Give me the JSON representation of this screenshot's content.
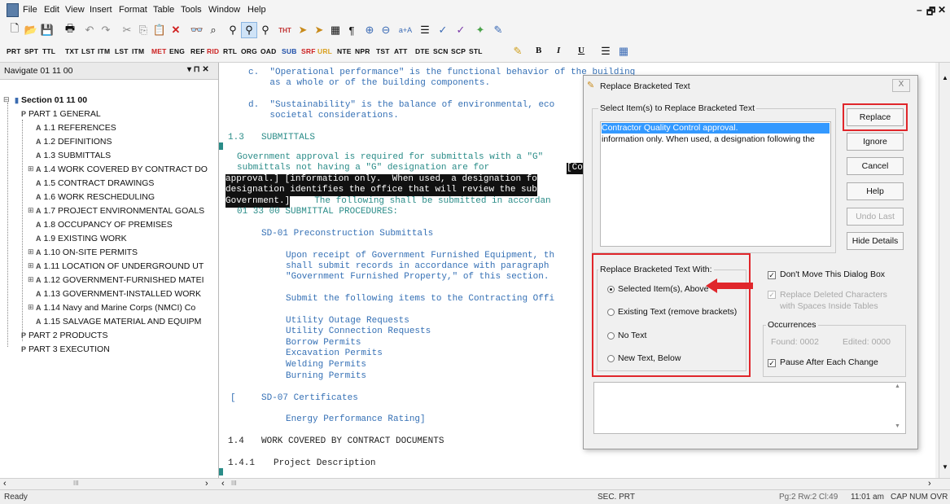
{
  "menu": [
    "File",
    "Edit",
    "View",
    "Insert",
    "Format",
    "Table",
    "Tools",
    "Window",
    "Help"
  ],
  "window_controls": {
    "minimize": "–",
    "restore": "🗗",
    "close": "✕"
  },
  "toolbar2": [
    "PRT",
    "SPT",
    "TTL",
    "TXT",
    "LST",
    "ITM",
    "LST",
    "ITM",
    "MET",
    "ENG",
    "REF",
    "RID",
    "RTL",
    "ORG",
    "OAD",
    "SUB",
    "SRF",
    "URL",
    "NTE",
    "NPR",
    "TST",
    "ATT",
    "DTE",
    "SCN",
    "SCP",
    "STL",
    "B",
    "I",
    "U"
  ],
  "navigator": {
    "title": "Navigate 01 11 00",
    "pin": "▾ ⊓ ✕",
    "items": [
      {
        "label": "Section 01 11 00"
      },
      {
        "label": "PART 1  GENERAL"
      },
      {
        "label": "1.1  REFERENCES"
      },
      {
        "label": "1.2  DEFINITIONS"
      },
      {
        "label": "1.3  SUBMITTALS"
      },
      {
        "label": "1.4  WORK COVERED BY CONTRACT DO"
      },
      {
        "label": "1.5  CONTRACT DRAWINGS"
      },
      {
        "label": "1.6  WORK RESCHEDULING"
      },
      {
        "label": "1.7  PROJECT ENVIRONMENTAL GOALS"
      },
      {
        "label": "1.8  OCCUPANCY OF PREMISES"
      },
      {
        "label": "1.9  EXISTING WORK"
      },
      {
        "label": "1.10  ON-SITE PERMITS"
      },
      {
        "label": "1.11  LOCATION OF UNDERGROUND UT"
      },
      {
        "label": "1.12  GOVERNMENT-FURNISHED MATEI"
      },
      {
        "label": "1.13  GOVERNMENT-INSTALLED WORK"
      },
      {
        "label": "1.14  Navy and Marine Corps (NMCI) Co"
      },
      {
        "label": "1.15  SALVAGE MATERIAL AND EQUIPM"
      },
      {
        "label": "PART 2  PRODUCTS"
      },
      {
        "label": "PART 3  EXECUTION"
      }
    ]
  },
  "document": {
    "lines": [
      "c.  \"Operational performance\" is the functional behavior of the building",
      "    as a whole or of the building components.",
      "d.  \"Sustainability\" is the balance of environmental, eco",
      "    societal considerations.",
      "1.3",
      "SUBMITTALS",
      "Government approval is required for submittals with a \"G\"",
      "submittals not having a \"G\" designation are for ",
      "[Contracto",
      "approval.] [information only.  When used, a designation fo",
      "designation identifies the office that will review the sub",
      "Government.]",
      "  The following shall be submitted in accordan",
      "01 33 00 SUBMITTAL PROCEDURES:",
      "SD-01 Preconstruction Submittals",
      "Upon receipt of Government Furnished Equipment, th",
      "shall submit records in accordance with paragraph",
      "\"Government Furnished Property,\" of this section.",
      "Submit the following items to the Contracting Offi",
      "Utility Outage Requests",
      "Utility Connection Requests",
      "Borrow Permits",
      "Excavation Permits",
      "Welding Permits",
      "Burning Permits",
      "[",
      "SD-07 Certificates",
      "Energy Performance Rating]",
      "1.4",
      "WORK COVERED BY CONTRACT DOCUMENTS",
      "1.4.1",
      "Project Description"
    ]
  },
  "dialog": {
    "title": "Replace Bracketed Text",
    "close": "X",
    "select_group_title": "Select Item(s) to Replace Bracketed Text",
    "list_items": [
      "Contractor Quality Control approval.",
      "information only.  When used, a designation following the"
    ],
    "buttons": {
      "replace": "Replace",
      "ignore": "Ignore",
      "cancel": "Cancel",
      "help": "Help",
      "undo_last": "Undo Last",
      "hide_details": "Hide Details"
    },
    "replace_with_title": "Replace Bracketed Text With:",
    "radios": [
      "Selected Item(s), Above",
      "Existing Text (remove brackets)",
      "No Text",
      "New Text, Below"
    ],
    "dont_move": "Don't Move This Dialog Box",
    "replace_deleted": "Replace Deleted Characters with Spaces Inside Tables",
    "occurrences_title": "Occurrences",
    "found": "Found: 0002",
    "edited": "Edited: 0000",
    "pause": "Pause After Each Change"
  },
  "status": {
    "ready": "Ready",
    "mode": "SEC. PRT",
    "position": "Pg:2 Rw:2 Cl:49",
    "time": "11:01 am",
    "flags": "CAP NUM OVR"
  },
  "hscroll": {
    "left": "‹",
    "thumb": "III",
    "right": "›"
  }
}
